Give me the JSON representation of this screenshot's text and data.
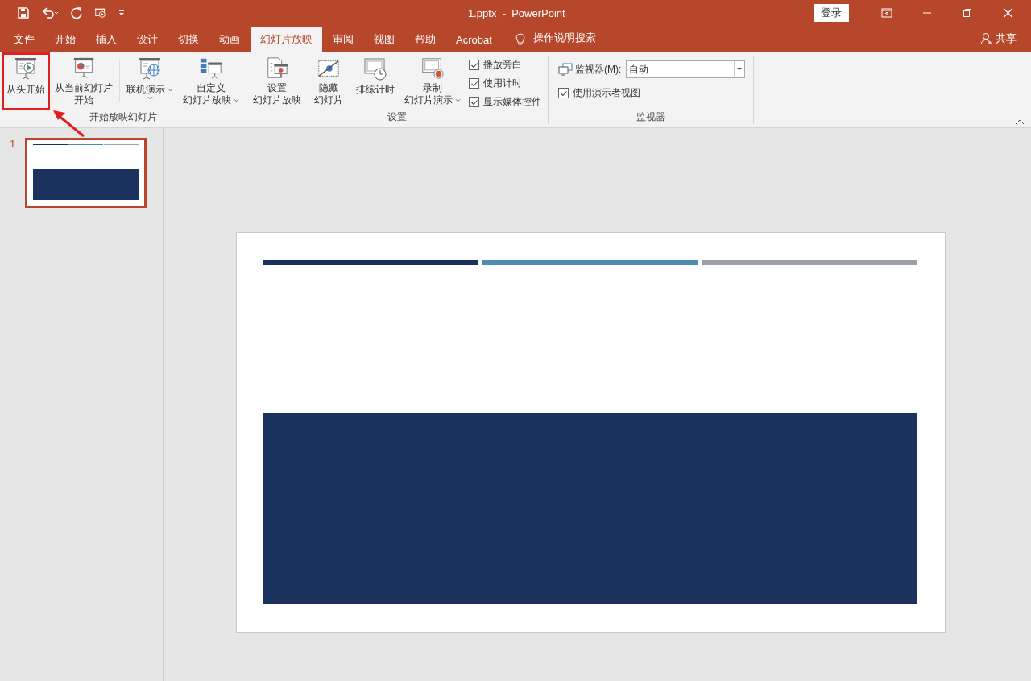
{
  "window": {
    "title": "1.pptx  -  PowerPoint",
    "login_button": "登录"
  },
  "tabs": [
    {
      "label": "文件",
      "selected": false
    },
    {
      "label": "开始",
      "selected": false
    },
    {
      "label": "插入",
      "selected": false
    },
    {
      "label": "设计",
      "selected": false
    },
    {
      "label": "切换",
      "selected": false
    },
    {
      "label": "动画",
      "selected": false
    },
    {
      "label": "幻灯片放映",
      "selected": true
    },
    {
      "label": "审阅",
      "selected": false
    },
    {
      "label": "视图",
      "selected": false
    },
    {
      "label": "帮助",
      "selected": false
    },
    {
      "label": "Acrobat",
      "selected": false
    }
  ],
  "tell_me": {
    "placeholder": "操作说明搜索"
  },
  "share_button": "共享",
  "ribbon": {
    "groups": [
      {
        "title": "开始放映幻灯片",
        "buttons": [
          {
            "lines": [
              "从头开始"
            ],
            "dropdown": false,
            "highlighted": true
          },
          {
            "lines": [
              "从当前幻灯片",
              "开始"
            ],
            "dropdown": false,
            "highlighted": false
          },
          {
            "lines": [
              "联机演示"
            ],
            "dropdown": true,
            "highlighted": false
          },
          {
            "lines": [
              "自定义",
              "幻灯片放映"
            ],
            "dropdown": true,
            "highlighted": false
          }
        ]
      },
      {
        "title": "设置",
        "buttons": [
          {
            "lines": [
              "设置",
              "幻灯片放映"
            ],
            "dropdown": false,
            "highlighted": false
          },
          {
            "lines": [
              "隐藏",
              "幻灯片"
            ],
            "dropdown": false,
            "highlighted": false
          },
          {
            "lines": [
              "排练计时"
            ],
            "dropdown": false,
            "highlighted": false
          },
          {
            "lines": [
              "录制",
              "幻灯片演示"
            ],
            "dropdown": true,
            "highlighted": false
          }
        ],
        "checkboxes": [
          {
            "label": "播放旁白",
            "checked": true
          },
          {
            "label": "使用计时",
            "checked": true
          },
          {
            "label": "显示媒体控件",
            "checked": true
          }
        ]
      },
      {
        "title": "监视器",
        "monitor": {
          "label": "监视器(M):",
          "value": "自动"
        },
        "checkboxes": [
          {
            "label": "使用演示者视图",
            "checked": true
          }
        ]
      }
    ]
  },
  "thumbnails": [
    {
      "number": "1",
      "selected": true
    }
  ]
}
